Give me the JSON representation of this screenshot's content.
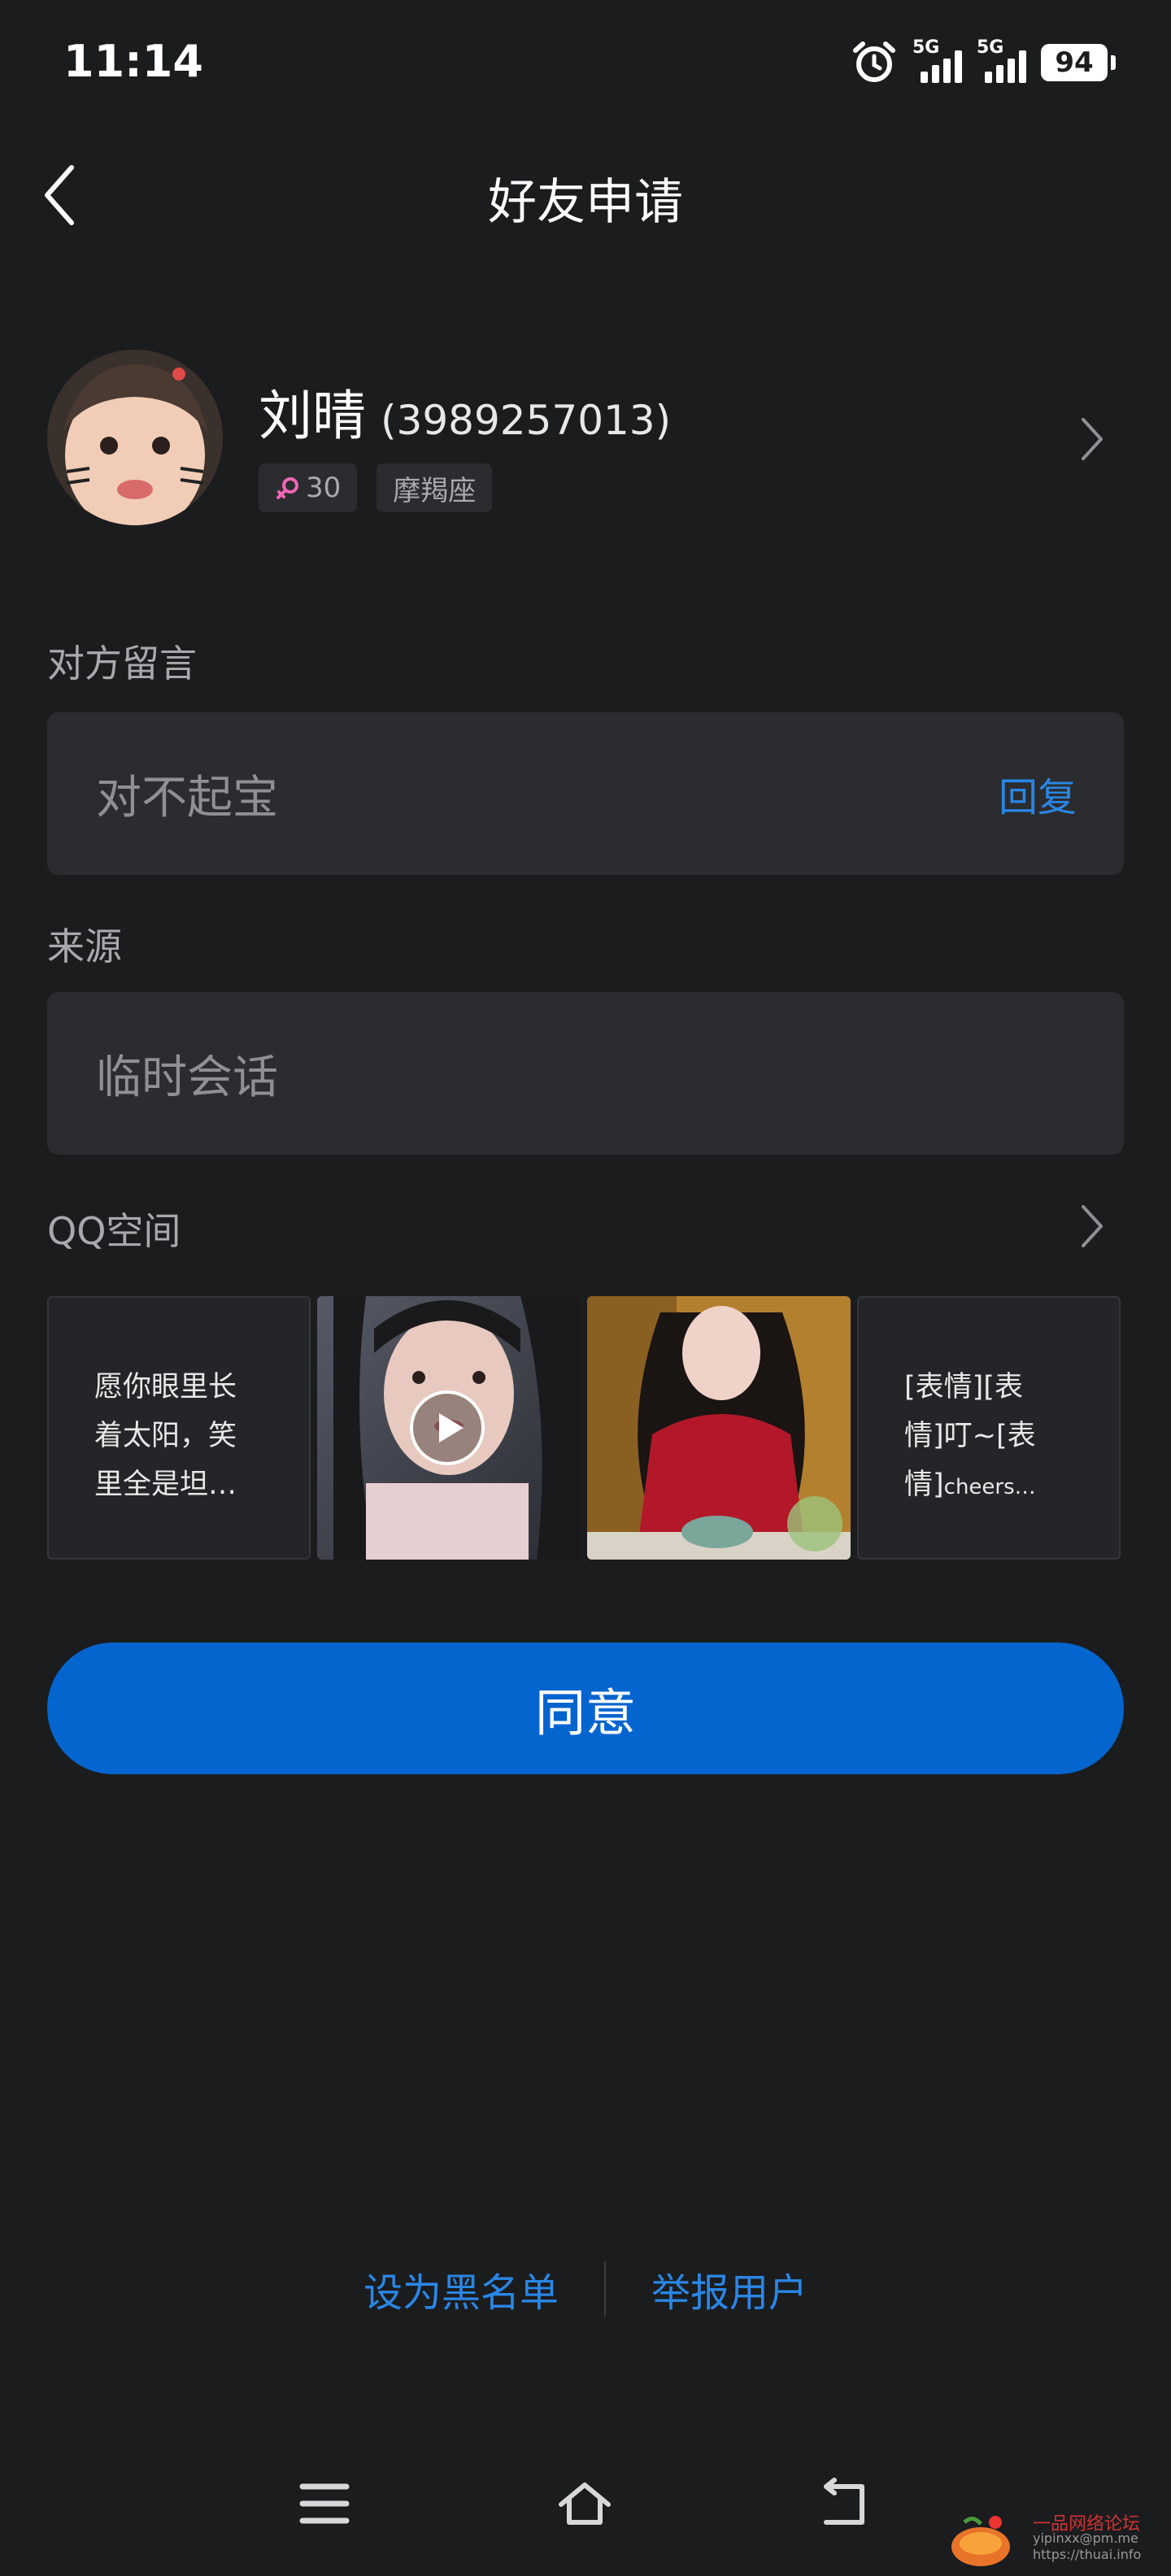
{
  "status_bar": {
    "time": "11:14",
    "net1": "5G",
    "net2": "5G",
    "battery": "94"
  },
  "header": {
    "title": "好友申请"
  },
  "profile": {
    "name": "刘晴",
    "qq": "(3989257013)",
    "age": "30",
    "constellation": "摩羯座"
  },
  "message": {
    "label": "对方留言",
    "text": "对不起宝",
    "reply": "回复"
  },
  "source": {
    "label": "来源",
    "text": "临时会话"
  },
  "qzone": {
    "label": "QQ空间",
    "tile1": {
      "line1": "愿你眼里长",
      "line2": "着太阳，笑",
      "line3": "里全是坦…"
    },
    "tile4": {
      "line1": "[表情][表",
      "line2": "情]叮~[表",
      "line3a": "情]",
      "line3b": "cheers…"
    }
  },
  "agree_button": "同意",
  "actions": {
    "blacklist": "设为黑名单",
    "report": "举报用户"
  },
  "watermark": {
    "title": "一品网络论坛",
    "line1": "yipinxx@pm.me",
    "line2": "https://thuai.info"
  },
  "colors": {
    "accent": "#2a86e5",
    "button": "#0465cf",
    "background": "#1b1c1e",
    "card": "#2b2c2f"
  }
}
